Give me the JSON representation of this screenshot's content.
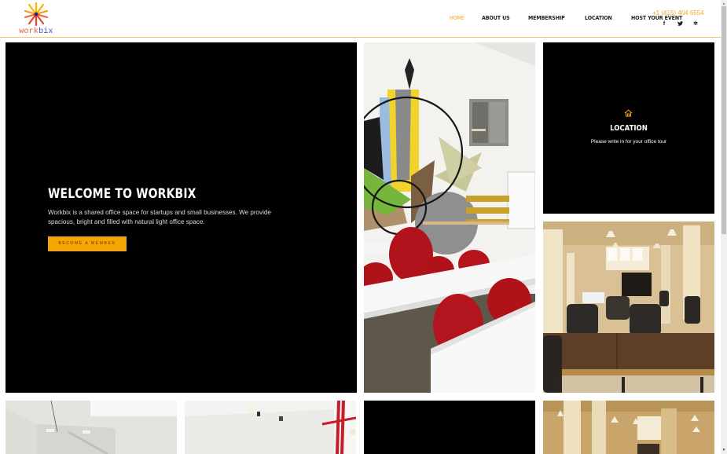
{
  "brand": {
    "logo_prefix": "work",
    "logo_suffix": "bix",
    "accent_color": "#f5a623"
  },
  "nav": {
    "items": [
      {
        "label": "HOME",
        "active": true
      },
      {
        "label": "ABOUT US",
        "active": false
      },
      {
        "label": "MEMBERSHIP",
        "active": false
      },
      {
        "label": "LOCATION",
        "active": false
      },
      {
        "label": "HOST YOUR EVENT",
        "active": false
      }
    ]
  },
  "contact": {
    "phone": "+1 (415) 404 6554",
    "socials": [
      {
        "name": "facebook-icon",
        "glyph": "f"
      },
      {
        "name": "twitter-icon",
        "glyph": "🐦"
      },
      {
        "name": "yelp-icon",
        "glyph": "✲"
      }
    ]
  },
  "hero": {
    "title": "WELCOME TO WORKBIX",
    "text": "Workbix is a shared office space for startups and small businesses. We provide spacious, bright and filled with natural light office space.",
    "button_label": "BECOME A MEMBER"
  },
  "location_tile": {
    "icon": "home-icon",
    "title": "LOCATION",
    "text": "Please write in for your office tour"
  },
  "images": [
    {
      "name": "mural-room-image",
      "description": "Office room with colorful wall mural, white tables and red chairs"
    },
    {
      "name": "open-office-image",
      "description": "Open office with wooden desks and leather chairs"
    },
    {
      "name": "white-stairwell-image",
      "description": "White interior with stairwell and skylight"
    },
    {
      "name": "white-wall-red-pipe-image",
      "description": "White wall with red pipes and lights"
    },
    {
      "name": "office-columns-image",
      "description": "Office with columns and pendant lights"
    }
  ],
  "scrollbar": {
    "up": "▲",
    "down": "▼"
  }
}
